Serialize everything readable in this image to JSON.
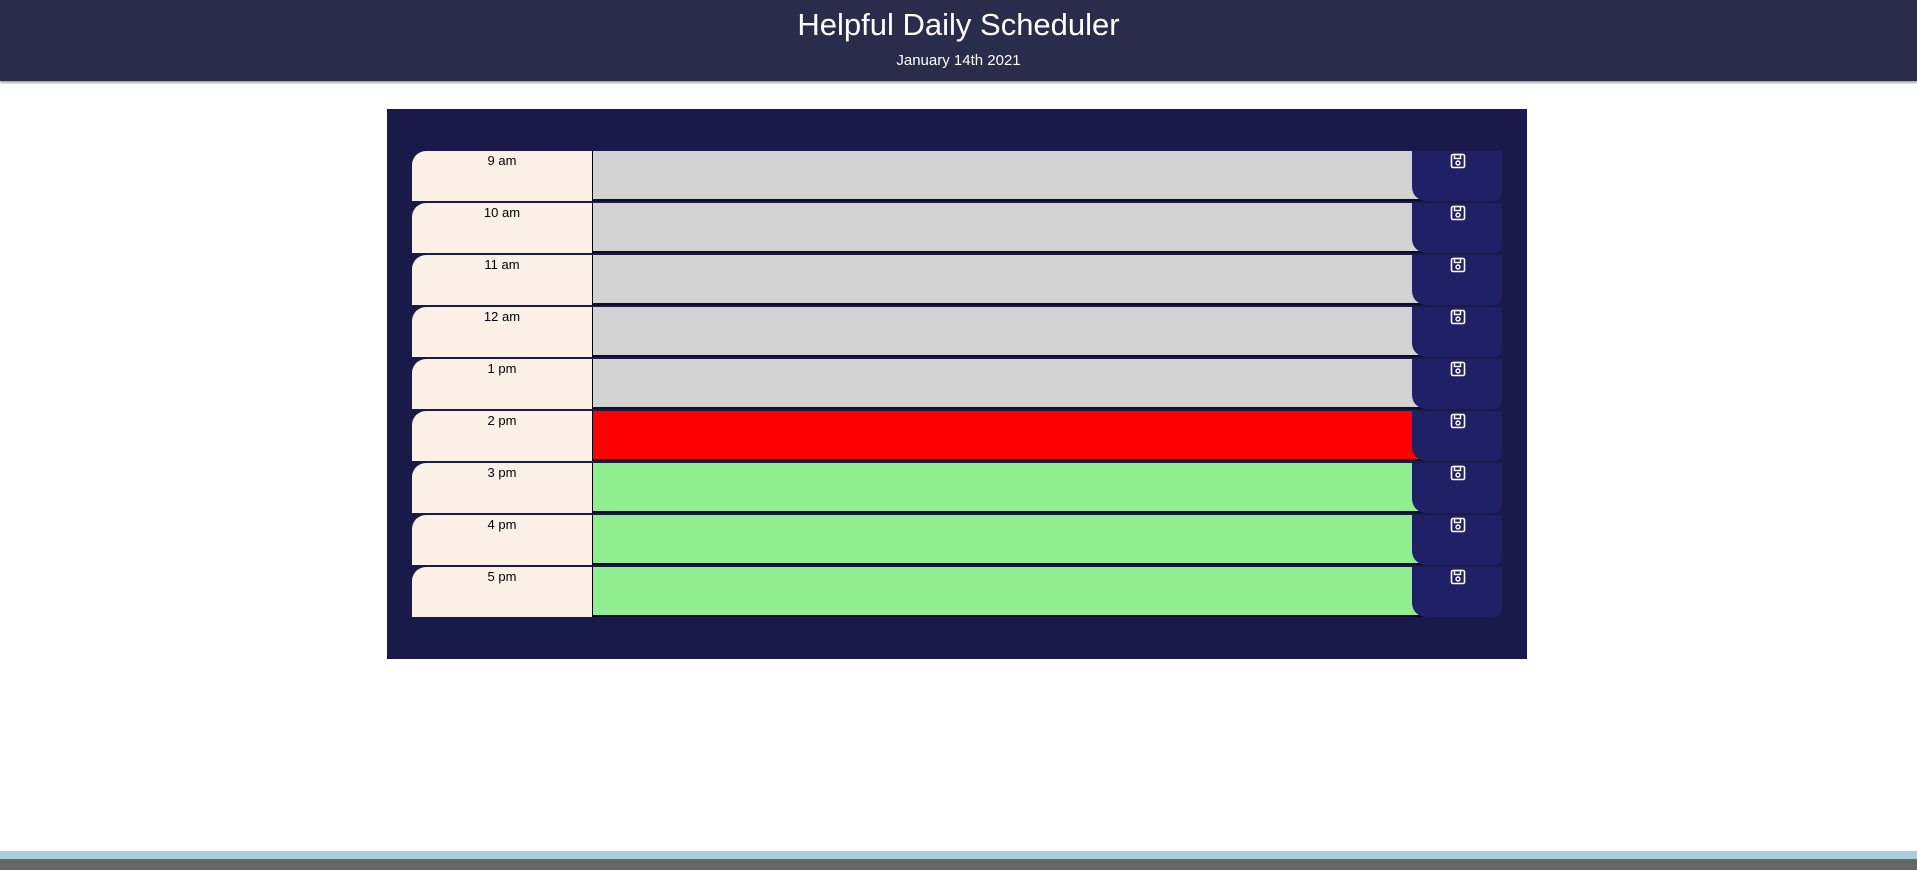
{
  "header": {
    "title": "Helpful Daily Scheduler",
    "date": "January 14th 2021"
  },
  "colors": {
    "past": "#d3d3d3",
    "present": "#ff0000",
    "future": "#90ee90",
    "save_button": "#202066",
    "container": "#19194a"
  },
  "hours": [
    {
      "label": "9 am",
      "state": "past",
      "text": ""
    },
    {
      "label": "10 am",
      "state": "past",
      "text": ""
    },
    {
      "label": "11 am",
      "state": "past",
      "text": ""
    },
    {
      "label": "12 am",
      "state": "past",
      "text": ""
    },
    {
      "label": "1 pm",
      "state": "past",
      "text": ""
    },
    {
      "label": "2 pm",
      "state": "present",
      "text": ""
    },
    {
      "label": "3 pm",
      "state": "future",
      "text": ""
    },
    {
      "label": "4 pm",
      "state": "future",
      "text": ""
    },
    {
      "label": "5 pm",
      "state": "future",
      "text": ""
    }
  ],
  "icons": {
    "save": "floppy-disk-icon"
  }
}
